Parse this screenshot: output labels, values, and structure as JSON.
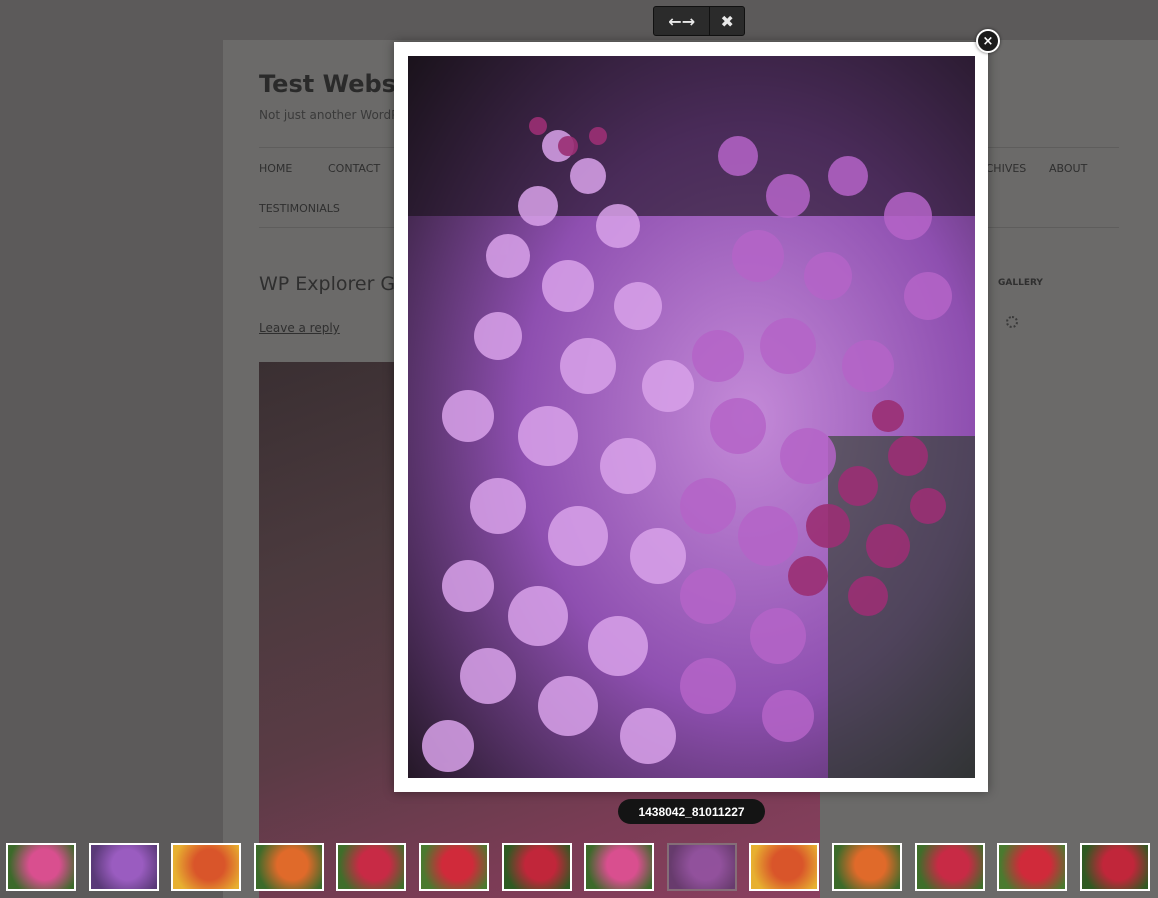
{
  "site": {
    "title": "Test Website",
    "tagline": "Not just another WordPress site"
  },
  "nav": {
    "items": [
      "HOME",
      "CONTACT",
      "ARCHIVES",
      "ABOUT",
      "TESTIMONIALS"
    ]
  },
  "post": {
    "title": "WP Explorer Gallery",
    "reply_link": "Leave a reply"
  },
  "sidebar": {
    "widget_title": "GALLERY"
  },
  "lightbox": {
    "prev_next_label": "←→",
    "toolbar_close": "✖",
    "close_button": "×",
    "caption": "1438042_81011227"
  },
  "thumbnails": [
    {
      "subject": "pink rose",
      "colors": [
        "#d94f8f",
        "#3c6a2a"
      ]
    },
    {
      "subject": "lilac",
      "colors": [
        "#9a5cc0",
        "#5a3a78"
      ]
    },
    {
      "subject": "flower bed",
      "colors": [
        "#d9552a",
        "#e7b030"
      ]
    },
    {
      "subject": "orange roses",
      "colors": [
        "#e06a2a",
        "#3d6b2a"
      ]
    },
    {
      "subject": "red rose",
      "colors": [
        "#c82a45",
        "#3f6e2a"
      ]
    },
    {
      "subject": "red rose",
      "colors": [
        "#d02a3a",
        "#4a7a2f"
      ]
    },
    {
      "subject": "red roses",
      "colors": [
        "#c1263a",
        "#2f5a22"
      ]
    },
    {
      "subject": "pink rose",
      "colors": [
        "#d94f8f",
        "#3c6a2a"
      ]
    },
    {
      "subject": "lilac",
      "colors": [
        "#9a5cc0",
        "#5a3a78"
      ],
      "active": true
    },
    {
      "subject": "flower bed",
      "colors": [
        "#d9552a",
        "#e7b030"
      ]
    },
    {
      "subject": "orange roses",
      "colors": [
        "#e06a2a",
        "#3d6b2a"
      ]
    },
    {
      "subject": "red rose",
      "colors": [
        "#c82a45",
        "#3f6e2a"
      ]
    },
    {
      "subject": "red rose",
      "colors": [
        "#d02a3a",
        "#4a7a2f"
      ]
    },
    {
      "subject": "red roses",
      "colors": [
        "#c1263a",
        "#2f5a22"
      ]
    }
  ]
}
